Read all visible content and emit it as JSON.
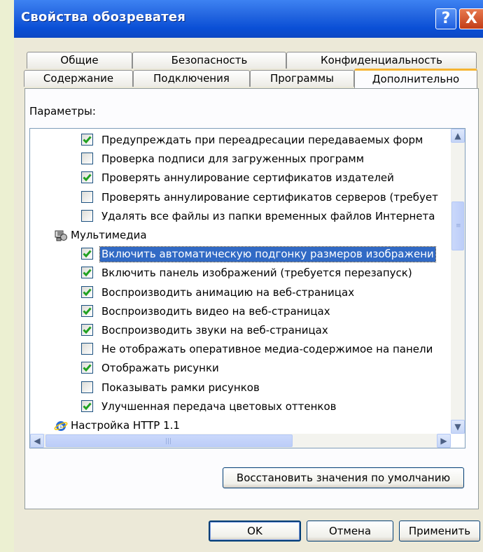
{
  "window": {
    "title": "Свойства обозреватея",
    "help_glyph": "?",
    "close_glyph": "X"
  },
  "tabs": {
    "row1": [
      {
        "label": "Общие"
      },
      {
        "label": "Безопасность"
      },
      {
        "label": "Конфиденциальность"
      }
    ],
    "row2": [
      {
        "label": "Содержание"
      },
      {
        "label": "Подключения"
      },
      {
        "label": "Программы"
      },
      {
        "label": "Дополнительно",
        "active": true
      }
    ]
  },
  "advanced": {
    "params_label": "Параметры:",
    "items": [
      {
        "type": "option",
        "checked": true,
        "label": "Предупреждать при переадресации передаваемых форм"
      },
      {
        "type": "option",
        "checked": false,
        "label": "Проверка подписи для загруженных программ"
      },
      {
        "type": "option",
        "checked": true,
        "label": "Проверять аннулирование сертификатов издателей"
      },
      {
        "type": "option",
        "checked": false,
        "label": "Проверять аннулирование сертификатов серверов (требует"
      },
      {
        "type": "option",
        "checked": false,
        "label": "Удалять все файлы из папки временных файлов Интернета"
      },
      {
        "type": "group",
        "icon": "multimedia-icon",
        "label": "Мультимедиа"
      },
      {
        "type": "option",
        "checked": true,
        "selected": true,
        "label": "Включить автоматическую подгонку размеров изображени"
      },
      {
        "type": "option",
        "checked": true,
        "label": "Включить панель изображений (требуется перезапуск)"
      },
      {
        "type": "option",
        "checked": true,
        "label": "Воспроизводить анимацию на веб-страницах"
      },
      {
        "type": "option",
        "checked": true,
        "label": "Воспроизводить видео на веб-страницах"
      },
      {
        "type": "option",
        "checked": true,
        "label": "Воспроизводить звуки на веб-страницах"
      },
      {
        "type": "option",
        "checked": false,
        "label": "Не отображать оперативное медиа-содержимое на панели"
      },
      {
        "type": "option",
        "checked": true,
        "label": "Отображать рисунки"
      },
      {
        "type": "option",
        "checked": false,
        "label": "Показывать рамки рисунков"
      },
      {
        "type": "option",
        "checked": true,
        "label": "Улучшенная передача цветовых оттенков"
      },
      {
        "type": "group",
        "icon": "internet-explorer-icon",
        "label": "Настройка HTTP 1.1"
      }
    ],
    "restore_defaults_label": "Восстановить значения по умолчанию"
  },
  "buttons": {
    "ok": "OK",
    "cancel": "Отмена",
    "apply": "Применить"
  },
  "colors": {
    "titlebar": "#0a4fd6",
    "selection": "#316ac5",
    "check": "#21a121",
    "active_tab_accent": "#f6b431"
  }
}
